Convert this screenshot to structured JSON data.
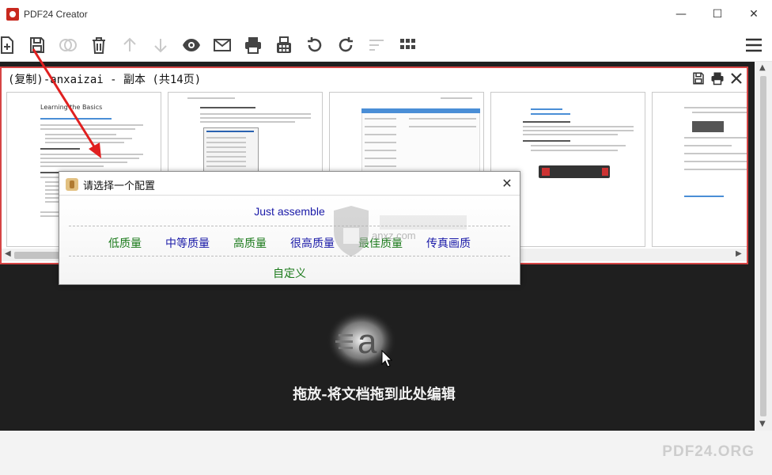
{
  "window": {
    "title": "PDF24 Creator",
    "minimize_glyph": "—",
    "maximize_glyph": "☐",
    "close_glyph": "✕"
  },
  "toolbar": {
    "buttons": [
      {
        "name": "add-file-icon",
        "enabled": true
      },
      {
        "name": "save-icon",
        "enabled": true
      },
      {
        "name": "merge-icon",
        "enabled": false
      },
      {
        "name": "delete-icon",
        "enabled": true
      },
      {
        "name": "move-up-icon",
        "enabled": false
      },
      {
        "name": "move-down-icon",
        "enabled": false
      },
      {
        "name": "preview-eye-icon",
        "enabled": true
      },
      {
        "name": "email-icon",
        "enabled": true
      },
      {
        "name": "print-icon",
        "enabled": true
      },
      {
        "name": "fax-icon",
        "enabled": true
      },
      {
        "name": "rotate-left-icon",
        "enabled": true
      },
      {
        "name": "rotate-right-icon",
        "enabled": true
      },
      {
        "name": "sort-icon",
        "enabled": false
      },
      {
        "name": "grid-view-icon",
        "enabled": true
      },
      {
        "name": "hamburger-menu-icon",
        "enabled": true
      }
    ]
  },
  "document": {
    "title": "(复制)-anxaizai - 副本 (共14页)",
    "actions": [
      "save-icon",
      "print-icon",
      "close-icon"
    ]
  },
  "thumbnails": {
    "page1_heading": "Learning the Basics"
  },
  "dialog": {
    "title": "请选择一个配置",
    "close_glyph": "✕",
    "option_just": "Just assemble",
    "options": [
      {
        "label": "低质量",
        "color": "#1b7a1b"
      },
      {
        "label": "中等质量",
        "color": "#1a1aa8"
      },
      {
        "label": "高质量",
        "color": "#1b7a1b"
      },
      {
        "label": "很高质量",
        "color": "#1a1aa8"
      },
      {
        "label": "最佳质量",
        "color": "#1b7a1b"
      },
      {
        "label": "传真画质",
        "color": "#1a1aa8"
      }
    ],
    "option_custom": "自定义"
  },
  "dropzone": {
    "text": "拖放-将文档拖到此处编辑"
  },
  "watermark": {
    "text": "anxz.com"
  },
  "footer": {
    "brand": "PDF24.ORG"
  }
}
